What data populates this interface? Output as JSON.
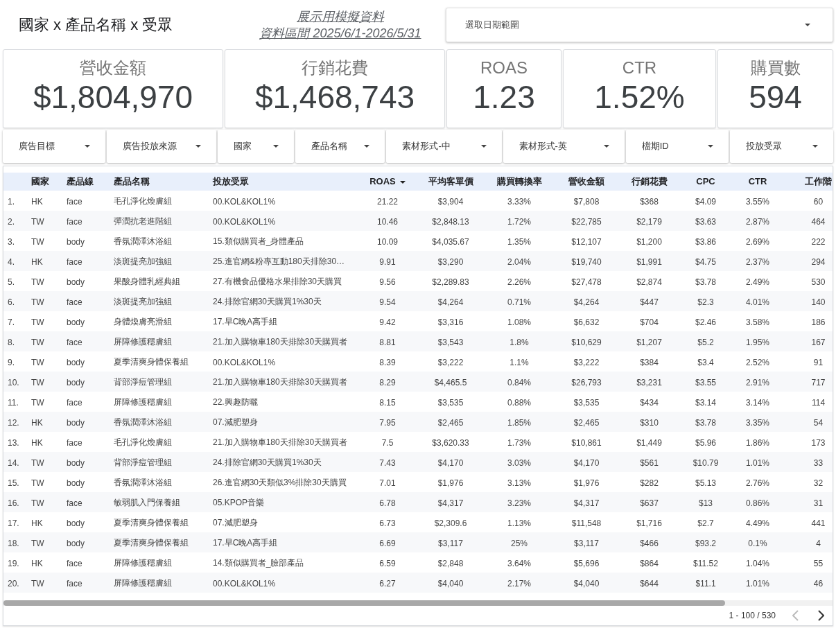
{
  "header": {
    "title": "國家 x 產品名稱 x 受眾",
    "subtitle_lines": [
      "展示用模擬資料",
      "資料區間 2025/6/1-2026/5/31"
    ],
    "date_picker": {
      "placeholder": "選取日期範圍"
    }
  },
  "kpis": [
    {
      "label": "營收金額",
      "value": "$1,804,970"
    },
    {
      "label": "行銷花費",
      "value": "$1,468,743"
    },
    {
      "label": "ROAS",
      "value": "1.23"
    },
    {
      "label": "CTR",
      "value": "1.52%"
    },
    {
      "label": "購買數",
      "value": "594"
    }
  ],
  "filters": [
    {
      "label": "廣告目標"
    },
    {
      "label": "廣告投放來源"
    },
    {
      "label": "國家"
    },
    {
      "label": "產品名稱"
    },
    {
      "label": "素材形式-中"
    },
    {
      "label": "素材形式-英"
    },
    {
      "label": "檔期ID"
    },
    {
      "label": "投放受眾"
    }
  ],
  "table": {
    "columns": [
      {
        "label": "國家",
        "kind": "text",
        "sorted": false
      },
      {
        "label": "產品線",
        "kind": "text",
        "sorted": false
      },
      {
        "label": "產品名稱",
        "kind": "text",
        "sorted": false
      },
      {
        "label": "投放受眾",
        "kind": "text",
        "sorted": false
      },
      {
        "label": "ROAS",
        "kind": "metric",
        "sorted": true
      },
      {
        "label": "平均客單價",
        "kind": "metric",
        "sorted": false
      },
      {
        "label": "購買轉換率",
        "kind": "metric",
        "sorted": false
      },
      {
        "label": "營收金額",
        "kind": "metric",
        "sorted": false
      },
      {
        "label": "行銷花費",
        "kind": "metric",
        "sorted": false
      },
      {
        "label": "CPC",
        "kind": "metric",
        "sorted": false
      },
      {
        "label": "CTR",
        "kind": "metric",
        "sorted": false
      },
      {
        "label": "工作階",
        "kind": "metric",
        "sorted": false
      }
    ],
    "rows": [
      {
        "index": "1.",
        "cells": [
          "HK",
          "face",
          "毛孔淨化煥膚組",
          "00.KOL&KOL1%",
          "21.22",
          "$3,904",
          "3.33%",
          "$7,808",
          "$368",
          "$4.09",
          "3.55%",
          "60"
        ]
      },
      {
        "index": "2.",
        "cells": [
          "TW",
          "face",
          "彈潤抗老進階組",
          "00.KOL&KOL1%",
          "10.46",
          "$2,848.13",
          "1.72%",
          "$22,785",
          "$2,179",
          "$3.63",
          "2.87%",
          "464"
        ]
      },
      {
        "index": "3.",
        "cells": [
          "TW",
          "body",
          "香氛潤澤沐浴組",
          "15.類似購買者_身體產品",
          "10.09",
          "$4,035.67",
          "1.35%",
          "$12,107",
          "$1,200",
          "$3.86",
          "2.69%",
          "222"
        ]
      },
      {
        "index": "4.",
        "cells": [
          "HK",
          "face",
          "淡斑提亮加強組",
          "25.進官網&粉專互動180天排除30…",
          "9.91",
          "$3,290",
          "2.04%",
          "$19,740",
          "$1,991",
          "$4.75",
          "2.37%",
          "294"
        ]
      },
      {
        "index": "5.",
        "cells": [
          "TW",
          "body",
          "果酸身體乳經典組",
          "27.有機食品優格水果排除30天購買",
          "9.56",
          "$2,289.83",
          "2.26%",
          "$27,478",
          "$2,874",
          "$3.78",
          "2.49%",
          "530"
        ]
      },
      {
        "index": "6.",
        "cells": [
          "TW",
          "face",
          "淡斑提亮加強組",
          "24.排除官網30天購買1%30天",
          "9.54",
          "$4,264",
          "0.71%",
          "$4,264",
          "$447",
          "$2.3",
          "4.01%",
          "140"
        ]
      },
      {
        "index": "7.",
        "cells": [
          "TW",
          "body",
          "身體煥膚亮滑組",
          "17.早C晚A高手組",
          "9.42",
          "$3,316",
          "1.08%",
          "$6,632",
          "$704",
          "$2.46",
          "3.58%",
          "186"
        ]
      },
      {
        "index": "8.",
        "cells": [
          "TW",
          "face",
          "屏障修護穩膚組",
          "21.加入購物車180天排除30天購買者",
          "8.81",
          "$3,543",
          "1.8%",
          "$10,629",
          "$1,207",
          "$5.2",
          "1.95%",
          "167"
        ]
      },
      {
        "index": "9.",
        "cells": [
          "TW",
          "body",
          "夏季清爽身體保養組",
          "00.KOL&KOL1%",
          "8.39",
          "$3,222",
          "1.1%",
          "$3,222",
          "$384",
          "$3.4",
          "2.52%",
          "91"
        ]
      },
      {
        "index": "10.",
        "cells": [
          "TW",
          "body",
          "背部淨痘管理組",
          "21.加入購物車180天排除30天購買者",
          "8.29",
          "$4,465.5",
          "0.84%",
          "$26,793",
          "$3,231",
          "$3.55",
          "2.91%",
          "717"
        ]
      },
      {
        "index": "11.",
        "cells": [
          "TW",
          "face",
          "屏障修護穩膚組",
          "22.興趣防曬",
          "8.15",
          "$3,535",
          "0.88%",
          "$3,535",
          "$434",
          "$3.14",
          "3.14%",
          "114"
        ]
      },
      {
        "index": "12.",
        "cells": [
          "HK",
          "body",
          "香氛潤澤沐浴組",
          "07.減肥塑身",
          "7.95",
          "$2,465",
          "1.85%",
          "$2,465",
          "$310",
          "$3.78",
          "3.35%",
          "54"
        ]
      },
      {
        "index": "13.",
        "cells": [
          "HK",
          "face",
          "毛孔淨化煥膚組",
          "21.加入購物車180天排除30天購買者",
          "7.5",
          "$3,620.33",
          "1.73%",
          "$10,861",
          "$1,449",
          "$5.96",
          "1.86%",
          "173"
        ]
      },
      {
        "index": "14.",
        "cells": [
          "TW",
          "body",
          "背部淨痘管理組",
          "24.排除官網30天購買1%30天",
          "7.43",
          "$4,170",
          "3.03%",
          "$4,170",
          "$561",
          "$10.79",
          "1.01%",
          "33"
        ]
      },
      {
        "index": "15.",
        "cells": [
          "TW",
          "body",
          "香氛潤澤沐浴組",
          "26.進官網30天類似3%排除30天購買",
          "7.01",
          "$1,976",
          "3.13%",
          "$1,976",
          "$282",
          "$5.13",
          "2.76%",
          "32"
        ]
      },
      {
        "index": "16.",
        "cells": [
          "TW",
          "face",
          "敏弱肌入門保養組",
          "05.KPOP音樂",
          "6.78",
          "$4,317",
          "3.23%",
          "$4,317",
          "$637",
          "$13",
          "0.86%",
          "31"
        ]
      },
      {
        "index": "17.",
        "cells": [
          "HK",
          "body",
          "夏季清爽身體保養組",
          "07.減肥塑身",
          "6.73",
          "$2,309.6",
          "1.13%",
          "$11,548",
          "$1,716",
          "$2.7",
          "4.49%",
          "441"
        ]
      },
      {
        "index": "18.",
        "cells": [
          "TW",
          "body",
          "夏季清爽身體保養組",
          "17.早C晚A高手組",
          "6.69",
          "$3,117",
          "25%",
          "$3,117",
          "$466",
          "$93.2",
          "0.1%",
          "4"
        ]
      },
      {
        "index": "19.",
        "cells": [
          "HK",
          "face",
          "屏障修護穩膚組",
          "14.類似購買者_臉部產品",
          "6.59",
          "$2,848",
          "3.64%",
          "$5,696",
          "$864",
          "$11.52",
          "1.04%",
          "55"
        ]
      },
      {
        "index": "20.",
        "cells": [
          "TW",
          "face",
          "屏障修護穩膚組",
          "00.KOL&KOL1%",
          "6.27",
          "$4,040",
          "2.17%",
          "$4,040",
          "$644",
          "$11.1",
          "1.01%",
          "46"
        ]
      }
    ],
    "pagination": {
      "range": "1 - 100 / 530",
      "previous": {
        "disabled": true
      },
      "next": {
        "disabled": false
      }
    }
  }
}
